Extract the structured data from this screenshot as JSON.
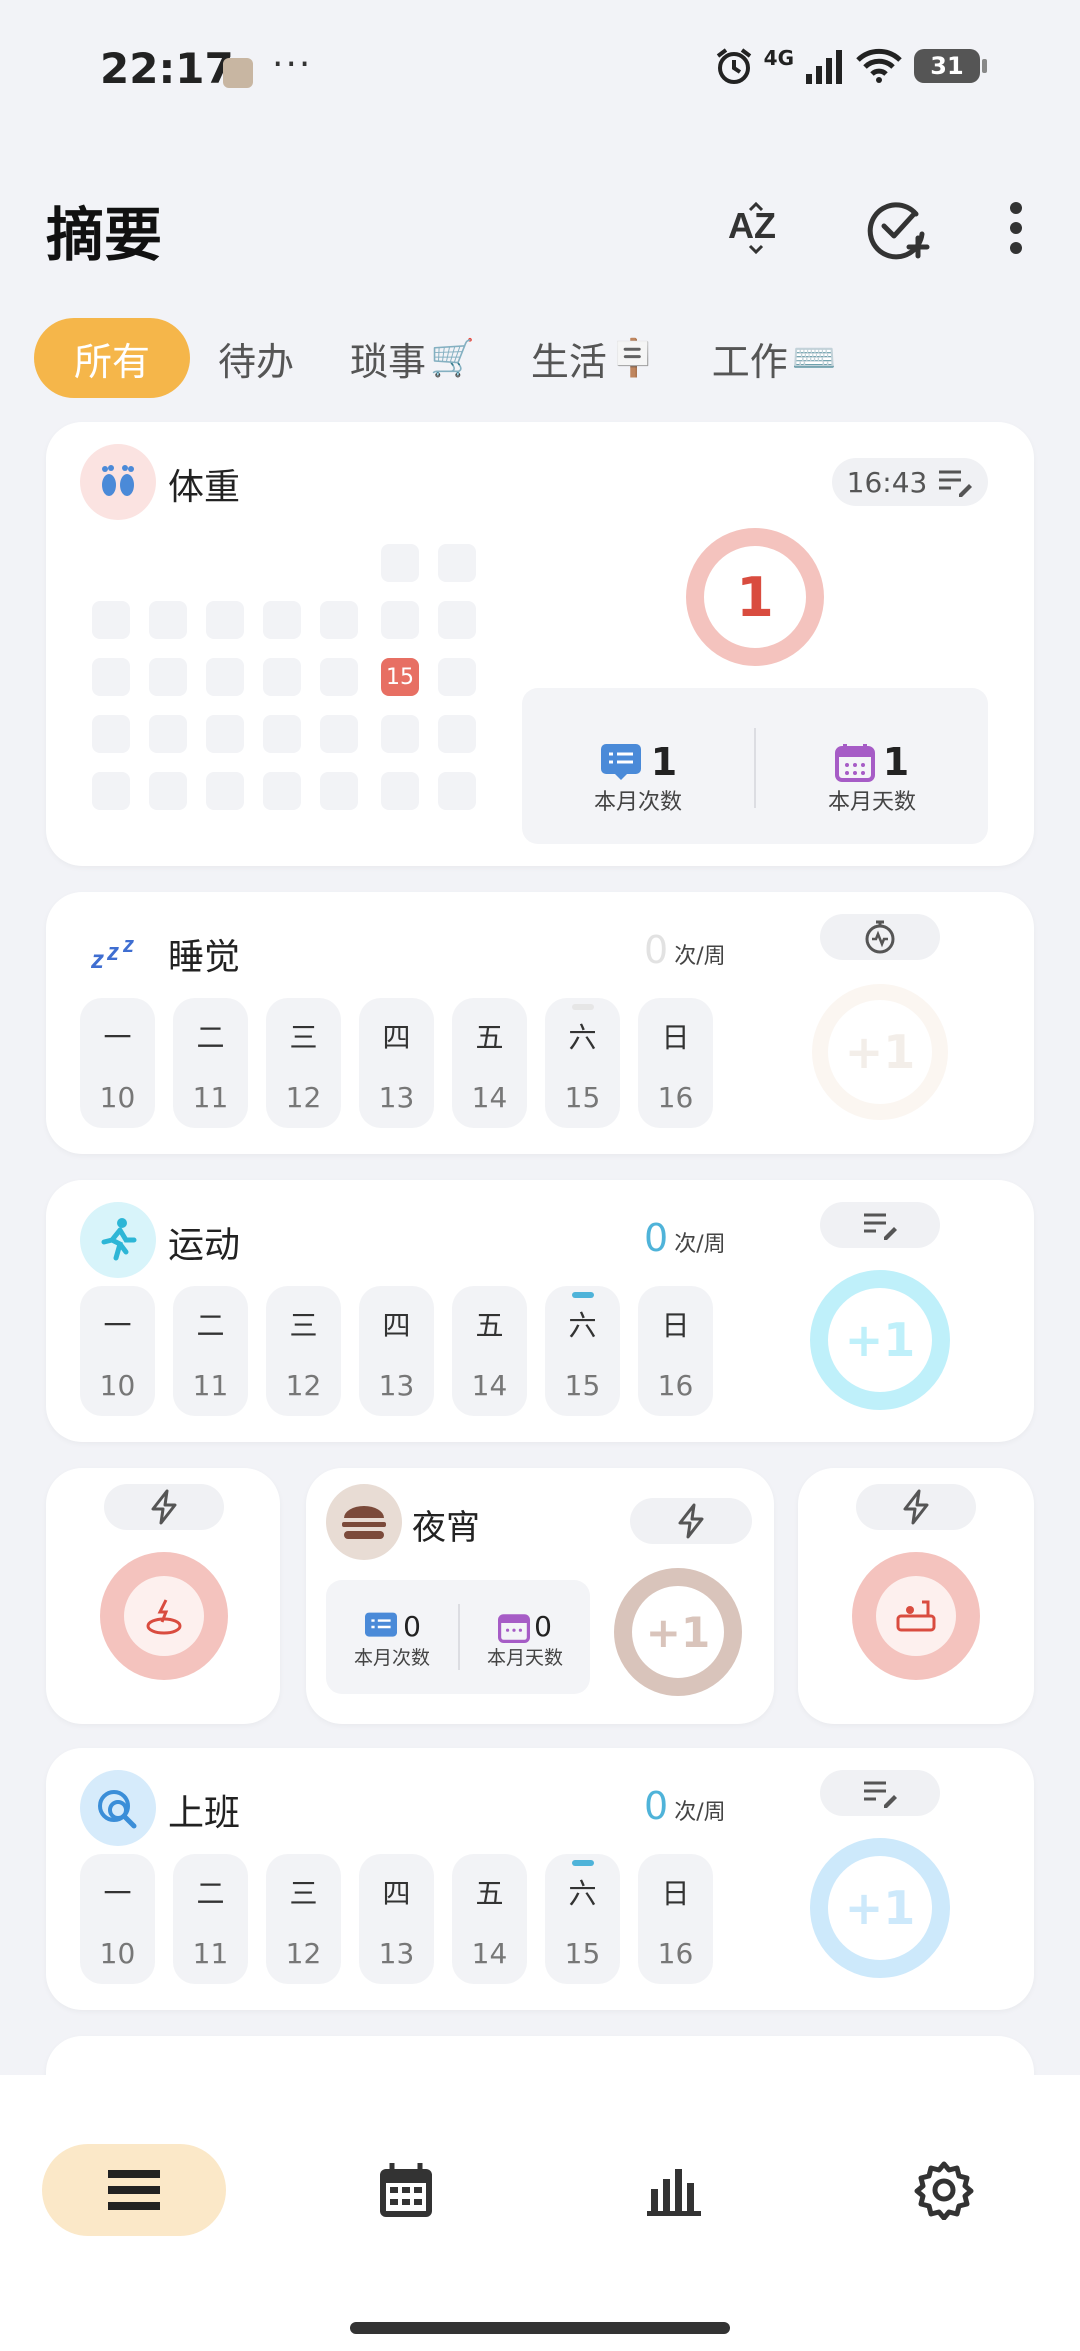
{
  "status": {
    "time": "22:17",
    "dots": "···",
    "network": "4G",
    "battery": "31"
  },
  "header": {
    "title": "摘要"
  },
  "tabs": [
    {
      "label": "所有",
      "emoji": ""
    },
    {
      "label": "待办",
      "emoji": ""
    },
    {
      "label": "琐事",
      "emoji": "🛒"
    },
    {
      "label": "生活",
      "emoji": "🪧"
    },
    {
      "label": "工作",
      "emoji": "⌨️"
    }
  ],
  "weight": {
    "title": "体重",
    "time": "16:43",
    "count": "1",
    "today": "15",
    "month_times_num": "1",
    "month_times_label": "本月次数",
    "month_days_num": "1",
    "month_days_label": "本月天数"
  },
  "weekdays": [
    "一",
    "二",
    "三",
    "四",
    "五",
    "六",
    "日"
  ],
  "dates": [
    "10",
    "11",
    "12",
    "13",
    "14",
    "15",
    "16"
  ],
  "sleep": {
    "title": "睡觉",
    "count": "0",
    "unit": "次/周",
    "ring_label": "+1"
  },
  "exercise": {
    "title": "运动",
    "count": "0",
    "unit": "次/周",
    "ring_label": "+1"
  },
  "snack": {
    "title": "夜宵",
    "month_times_num": "0",
    "month_times_label": "本月次数",
    "month_days_num": "0",
    "month_days_label": "本月天数",
    "ring_label": "+1"
  },
  "work": {
    "title": "上班",
    "count": "0",
    "unit": "次/周",
    "ring_label": "+1"
  },
  "colors": {
    "accent": "#f5b64a",
    "weight_ring": "#f4c3be",
    "weight_text": "#d94c3f",
    "exercise_ring": "#bff0fa",
    "work_ring": "#cde9fb",
    "count_blue": "#4fb3d9"
  },
  "icons": {
    "sort": "sort-az-icon",
    "add_task": "check-plus-icon",
    "more": "more-vertical-icon"
  }
}
